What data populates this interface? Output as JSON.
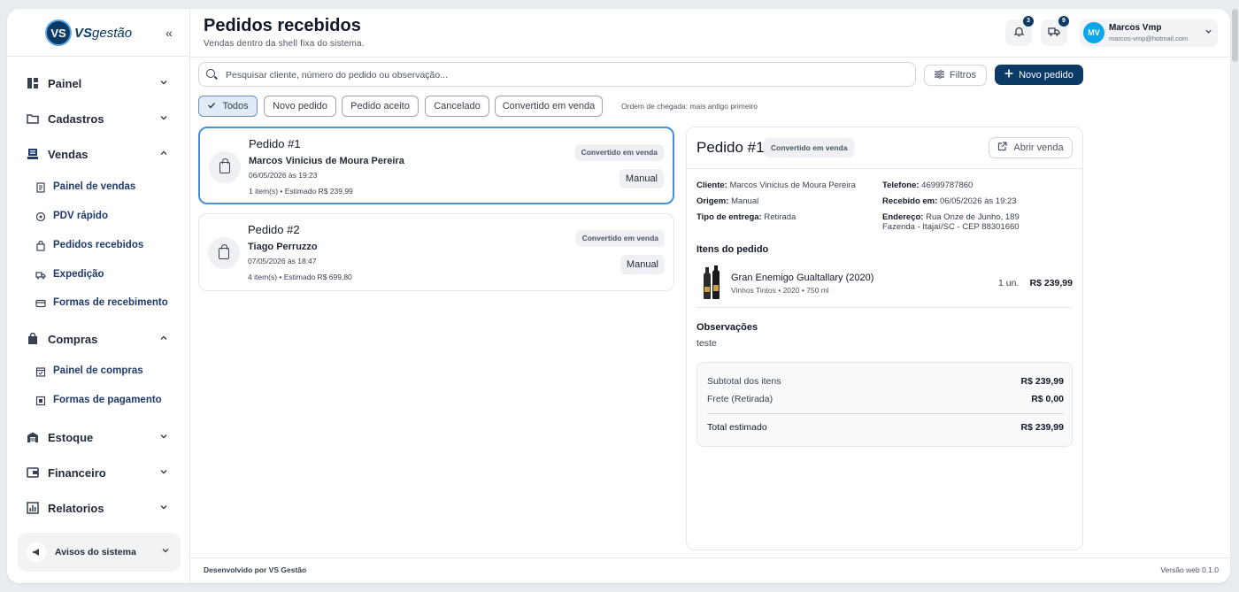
{
  "app": {
    "logo_initials": "VS",
    "logo_brand": "VS",
    "logo_suffix": "gestão",
    "collapse_icon": "«"
  },
  "sidebar": {
    "groups": [
      {
        "label": "Painel",
        "icon": "dashboard-icon",
        "chevron": "⌄"
      },
      {
        "label": "Cadastros",
        "icon": "folder-icon",
        "chevron": "⌄"
      },
      {
        "label": "Vendas",
        "icon": "sales-icon",
        "chevron": "⌃"
      },
      {
        "label": "Compras",
        "icon": "shopping-bag-icon",
        "chevron": "⌃"
      },
      {
        "label": "Estoque",
        "icon": "warehouse-icon",
        "chevron": "⌄"
      },
      {
        "label": "Financeiro",
        "icon": "wallet-icon",
        "chevron": "⌄"
      },
      {
        "label": "Relatorios",
        "icon": "chart-icon",
        "chevron": "⌄"
      }
    ],
    "vendas_items": [
      {
        "label": "Painel de vendas",
        "icon": "receipt-icon"
      },
      {
        "label": "PDV rápido",
        "icon": "location-icon"
      },
      {
        "label": "Pedidos recebidos",
        "icon": "bag-icon"
      },
      {
        "label": "Expedição",
        "icon": "truck-icon"
      },
      {
        "label": "Formas de recebimento",
        "icon": "card-icon"
      }
    ],
    "compras_items": [
      {
        "label": "Painel de compras",
        "icon": "cart-calendar-icon"
      },
      {
        "label": "Formas de pagamento",
        "icon": "payment-icon"
      }
    ],
    "avisos": {
      "label": "Avisos do sistema",
      "icon": "megaphone-icon"
    }
  },
  "header": {
    "title": "Pedidos recebidos",
    "subtitle": "Vendas dentro da shell fixa do sistema.",
    "notifications_count": "3",
    "delivery_count": "9",
    "user": {
      "initials": "MV",
      "name": "Marcos Vmp",
      "email": "marcos-vmp@hotmail.com"
    }
  },
  "toolbar": {
    "search_placeholder": "Pesquisar cliente, número do pedido ou observação...",
    "filters_label": "Filtros",
    "new_order_label": "Novo pedido"
  },
  "chips": [
    {
      "label": "Todos",
      "active": true
    },
    {
      "label": "Novo pedido",
      "active": false
    },
    {
      "label": "Pedido aceito",
      "active": false
    },
    {
      "label": "Cancelado",
      "active": false
    },
    {
      "label": "Convertido em venda",
      "active": false
    }
  ],
  "order_note": "Ordem de chegada: mais antigo primeiro",
  "orders": [
    {
      "title": "Pedido #1",
      "customer": "Marcos Vinicius de Moura Pereira",
      "date": "06/05/2026 às 19:23",
      "estimate": "1 item(s) • Estimado R$ 239,99",
      "status": "Convertido em venda",
      "origin": "Manual"
    },
    {
      "title": "Pedido #2",
      "customer": "Tiago Perruzzo",
      "date": "07/05/2026 às 18:47",
      "estimate": "4 item(s) • Estimado R$ 699,80",
      "status": "Convertido em venda",
      "origin": "Manual"
    }
  ],
  "detail": {
    "title": "Pedido #1",
    "status": "Convertido em venda",
    "open_sale_label": "Abrir venda",
    "cliente_label": "Cliente:",
    "cliente_value": "Marcos Vinicius de Moura Pereira",
    "origem_label": "Origem:",
    "origem_value": "Manual",
    "entrega_label": "Tipo de entrega:",
    "entrega_value": "Retirada",
    "telefone_label": "Telefone:",
    "telefone_value": "46999787860",
    "recebido_label": "Recebido em:",
    "recebido_value": "06/05/2026 às 19:23",
    "endereco_label": "Endereço:",
    "endereco_value": "Rua Onze de Junho, 189",
    "endereco_line2": "Fazenda - Itajaí/SC - CEP 88301660",
    "items_title": "Itens do pedido",
    "item": {
      "name": "Gran Enemigo Gualtallary (2020)",
      "meta": "Vinhos Tintos • 2020 • 750 ml",
      "qty": "1 un.",
      "price": "R$ 239,99"
    },
    "obs_title": "Observações",
    "obs_text": "teste",
    "subtotal_label": "Subtotal dos itens",
    "subtotal_value": "R$ 239,99",
    "frete_label": "Frete (Retirada)",
    "frete_value": "R$ 0,00",
    "total_label": "Total estimado",
    "total_value": "R$ 239,99"
  },
  "footer": {
    "left": "Desenvolvido por VS Gestão",
    "right": "Versão web 0.1.0"
  },
  "colors": {
    "primary": "#0b3a66",
    "accent_blue": "#4a90d9",
    "avatar": "#0ea5e9"
  }
}
